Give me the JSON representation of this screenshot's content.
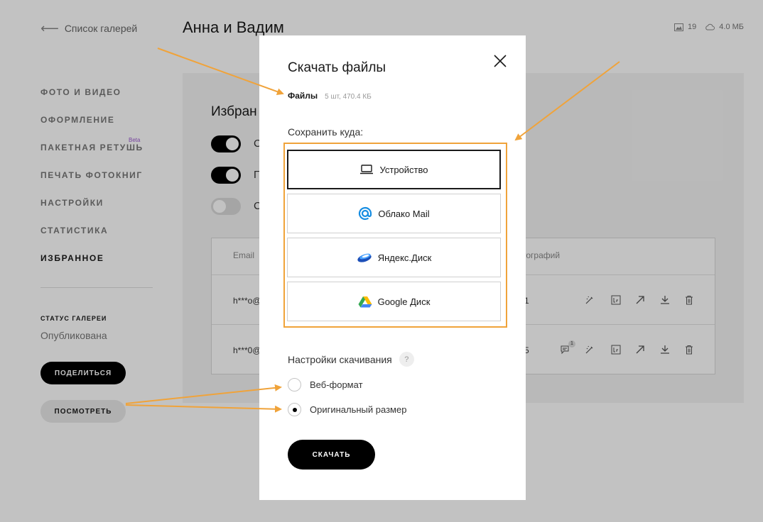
{
  "header": {
    "back_label": "Список галерей",
    "gallery_title": "Анна и Вадим",
    "photo_count": "19",
    "storage": "4.0 МБ"
  },
  "sidebar": {
    "items": [
      {
        "label": "ФОТО И ВИДЕО"
      },
      {
        "label": "ОФОРМЛЕНИЕ"
      },
      {
        "label": "ПАКЕТНАЯ РЕТУШЬ",
        "badge": "Beta"
      },
      {
        "label": "ПЕЧАТЬ ФОТОКНИГ"
      },
      {
        "label": "НАСТРОЙКИ"
      },
      {
        "label": "СТАТИСТИКА"
      },
      {
        "label": "ИЗБРАННОЕ"
      }
    ],
    "status_label": "СТАТУС ГАЛЕРЕИ",
    "status_value": "Опубликована",
    "share_button": "ПОДЕЛИТЬСЯ",
    "view_button": "ПОСМОТРЕТЬ"
  },
  "main": {
    "heading_partial": "Избран",
    "toggles": [
      {
        "label_partial": "С",
        "state": "on"
      },
      {
        "label_partial": "П",
        "state": "on"
      },
      {
        "label_partial": "С",
        "state": "off"
      }
    ],
    "table": {
      "col_email": "Email",
      "col_photos_partial": "тографий",
      "rows": [
        {
          "email_partial": "h***o@",
          "count_partial": "1"
        },
        {
          "email_partial": "h***0@",
          "count_partial": "5",
          "comment_badge": "1"
        }
      ]
    }
  },
  "modal": {
    "title": "Скачать файлы",
    "files_label": "Файлы",
    "files_meta": "5 шт, 470.4 КБ",
    "save_to_label": "Сохранить куда:",
    "destinations": [
      {
        "label": "Устройство",
        "icon": "laptop-icon",
        "selected": true
      },
      {
        "label": "Облако Mail",
        "icon": "mail-at-icon",
        "selected": false
      },
      {
        "label": "Яндекс.Диск",
        "icon": "yandex-disk-icon",
        "selected": false
      },
      {
        "label": "Google Диск",
        "icon": "google-drive-icon",
        "selected": false
      }
    ],
    "settings_label": "Настройки скачивания",
    "help_symbol": "?",
    "formats": [
      {
        "label": "Веб-формат",
        "checked": false
      },
      {
        "label": "Оригинальный размер",
        "checked": true
      }
    ],
    "download_button": "СКАЧАТЬ"
  },
  "colors": {
    "annotation_orange": "#f0a33a",
    "accent_black": "#000000",
    "beta_purple": "#9b59d0",
    "mail_blue": "#168de2"
  }
}
